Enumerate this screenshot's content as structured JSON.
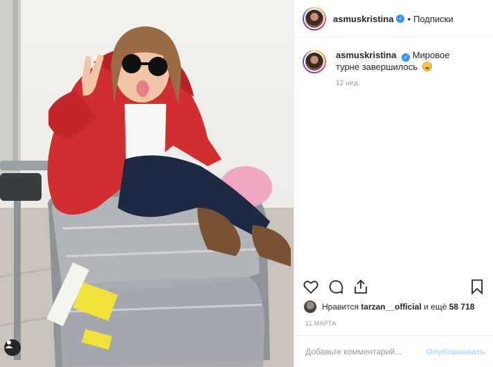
{
  "post": {
    "username": "asmuskristina",
    "verified": true,
    "follow_label": "Подписки",
    "separator": "•",
    "caption": "Мировое турне завершилось",
    "caption_emoji": "grinning-tongue-emoji",
    "time_ago": "12 нед.",
    "likes_prefix": "Нравится",
    "likes_user": "tarzan__official",
    "likes_middle": "и ещё",
    "likes_count": "58 718",
    "date": "11 МАРТА",
    "comment_placeholder": "Добавьте комментарий...",
    "publish_label": "Опубликовать"
  },
  "icons": {
    "like": "heart-icon",
    "comment": "comment-icon",
    "share": "share-icon",
    "save": "bookmark-icon",
    "verified": "verified-badge-icon",
    "photo_tag": "user-tag-icon"
  },
  "colors": {
    "accent": "#3897f0",
    "publish_disabled": "#b2dffc",
    "muted": "#999999",
    "text": "#262626"
  }
}
